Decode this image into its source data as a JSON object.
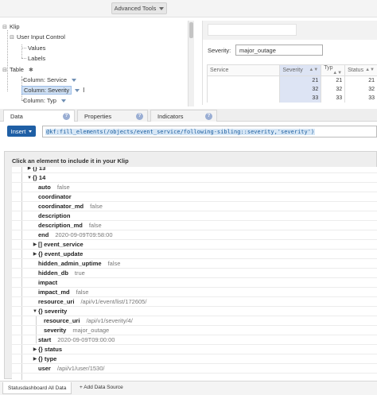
{
  "toolbar": {
    "advanced_tools_label": "Advanced Tools"
  },
  "tree": {
    "root": "Klip",
    "items": [
      {
        "label": "User Input Control"
      },
      {
        "label": "Values"
      },
      {
        "label": "Labels"
      },
      {
        "label": "Table"
      },
      {
        "label": "Column: Service"
      },
      {
        "label": "Column: Severity"
      },
      {
        "label": "Column: Typ"
      }
    ]
  },
  "preview": {
    "severity_label": "Severity:",
    "severity_value": "major_outage",
    "columns": [
      "Service",
      "Severity",
      "Typ",
      "Status"
    ],
    "rows": [
      [
        "",
        "21",
        "21",
        "21"
      ],
      [
        "",
        "32",
        "32",
        "32"
      ],
      [
        "",
        "33",
        "33",
        "33"
      ]
    ]
  },
  "tabs": [
    {
      "label": "Data"
    },
    {
      "label": "Properties"
    },
    {
      "label": "Indicators"
    }
  ],
  "insert": {
    "label": "Insert"
  },
  "formula": "@kf:fill_elements(/objects/event_service/following-sibling::severity,'severity')",
  "data_panel": {
    "header": "Click an element to include it in your Klip",
    "rows": [
      {
        "key": "{} 13",
        "val": ""
      },
      {
        "key": "{} 14",
        "val": ""
      },
      {
        "key": "auto",
        "val": "false"
      },
      {
        "key": "coordinator",
        "val": ""
      },
      {
        "key": "coordinator_md",
        "val": "false"
      },
      {
        "key": "description",
        "val": ""
      },
      {
        "key": "description_md",
        "val": "false"
      },
      {
        "key": "end",
        "val": "2020-09-09T09:58:00"
      },
      {
        "key": "[] event_service",
        "val": ""
      },
      {
        "key": "{} event_update",
        "val": ""
      },
      {
        "key": "hidden_admin_uptime",
        "val": "false"
      },
      {
        "key": "hidden_db",
        "val": "true"
      },
      {
        "key": "impact",
        "val": ""
      },
      {
        "key": "impact_md",
        "val": "false"
      },
      {
        "key": "resource_uri",
        "val": "/api/v1/event/list/172605/"
      },
      {
        "key": "{} severity",
        "val": ""
      },
      {
        "key": "resource_uri",
        "val": "/api/v1/severity/4/"
      },
      {
        "key": "severity",
        "val": "major_outage"
      },
      {
        "key": "start",
        "val": "2020-09-09T09:00:00"
      },
      {
        "key": "{} status",
        "val": ""
      },
      {
        "key": "{} type",
        "val": ""
      },
      {
        "key": "user",
        "val": "/api/v1/user/1530/"
      }
    ]
  },
  "bottom": {
    "source_tab": "Statusdashboard All Data",
    "add_source": "+ Add Data Source"
  }
}
